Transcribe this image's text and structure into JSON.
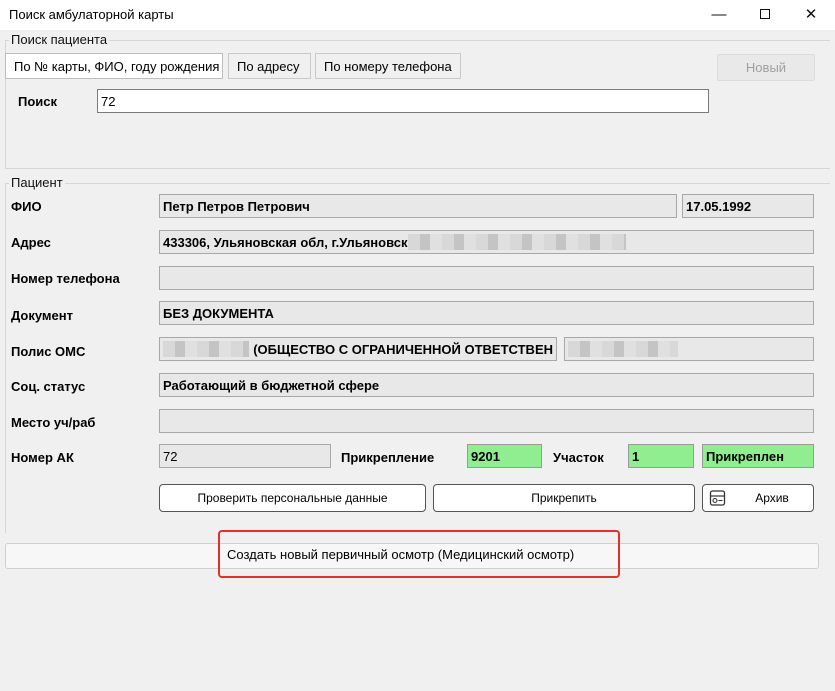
{
  "window": {
    "title": "Поиск амбулаторной карты",
    "minimize": "—",
    "close": "✕"
  },
  "search_group": {
    "label": "Поиск пациента",
    "tabs": [
      {
        "label": "По № карты, ФИО, году рождения",
        "active": true
      },
      {
        "label": "По адресу",
        "active": false
      },
      {
        "label": "По номеру телефона",
        "active": false
      }
    ],
    "new_button": "Новый",
    "search_label": "Поиск",
    "search_value": "72"
  },
  "patient_group": {
    "label": "Пациент",
    "fio_label": "ФИО",
    "fio_value": "Петр Петров Петрович",
    "birth_date": "17.05.1992",
    "address_label": "Адрес",
    "address_value": "433306, Ульяновская обл, г.Ульяновск",
    "phone_label": "Номер телефона",
    "phone_value": "",
    "document_label": "Документ",
    "document_value": "БЕЗ ДОКУМЕНТА",
    "policy_label": "Полис ОМС",
    "policy_company": "(ОБЩЕСТВО С ОГРАНИЧЕННОЙ ОТВЕТСТВЕН",
    "social_label": "Соц. статус",
    "social_value": "Работающий в бюджетной сфере",
    "work_label": "Место уч/раб",
    "work_value": "",
    "ak_label": "Номер АК",
    "ak_value": "72",
    "attach_label": "Прикрепление",
    "attach_value": "9201",
    "area_label": "Участок",
    "area_value": "1",
    "status_value": "Прикреплен",
    "verify_button": "Проверить персональные данные",
    "attach_button": "Прикрепить",
    "archive_button": "Архив"
  },
  "create_exam": {
    "label": "Создать новый первичный осмотр (Медицинский осмотр)"
  },
  "colors": {
    "green_field": "#90ee90",
    "highlight": "#e03131"
  }
}
